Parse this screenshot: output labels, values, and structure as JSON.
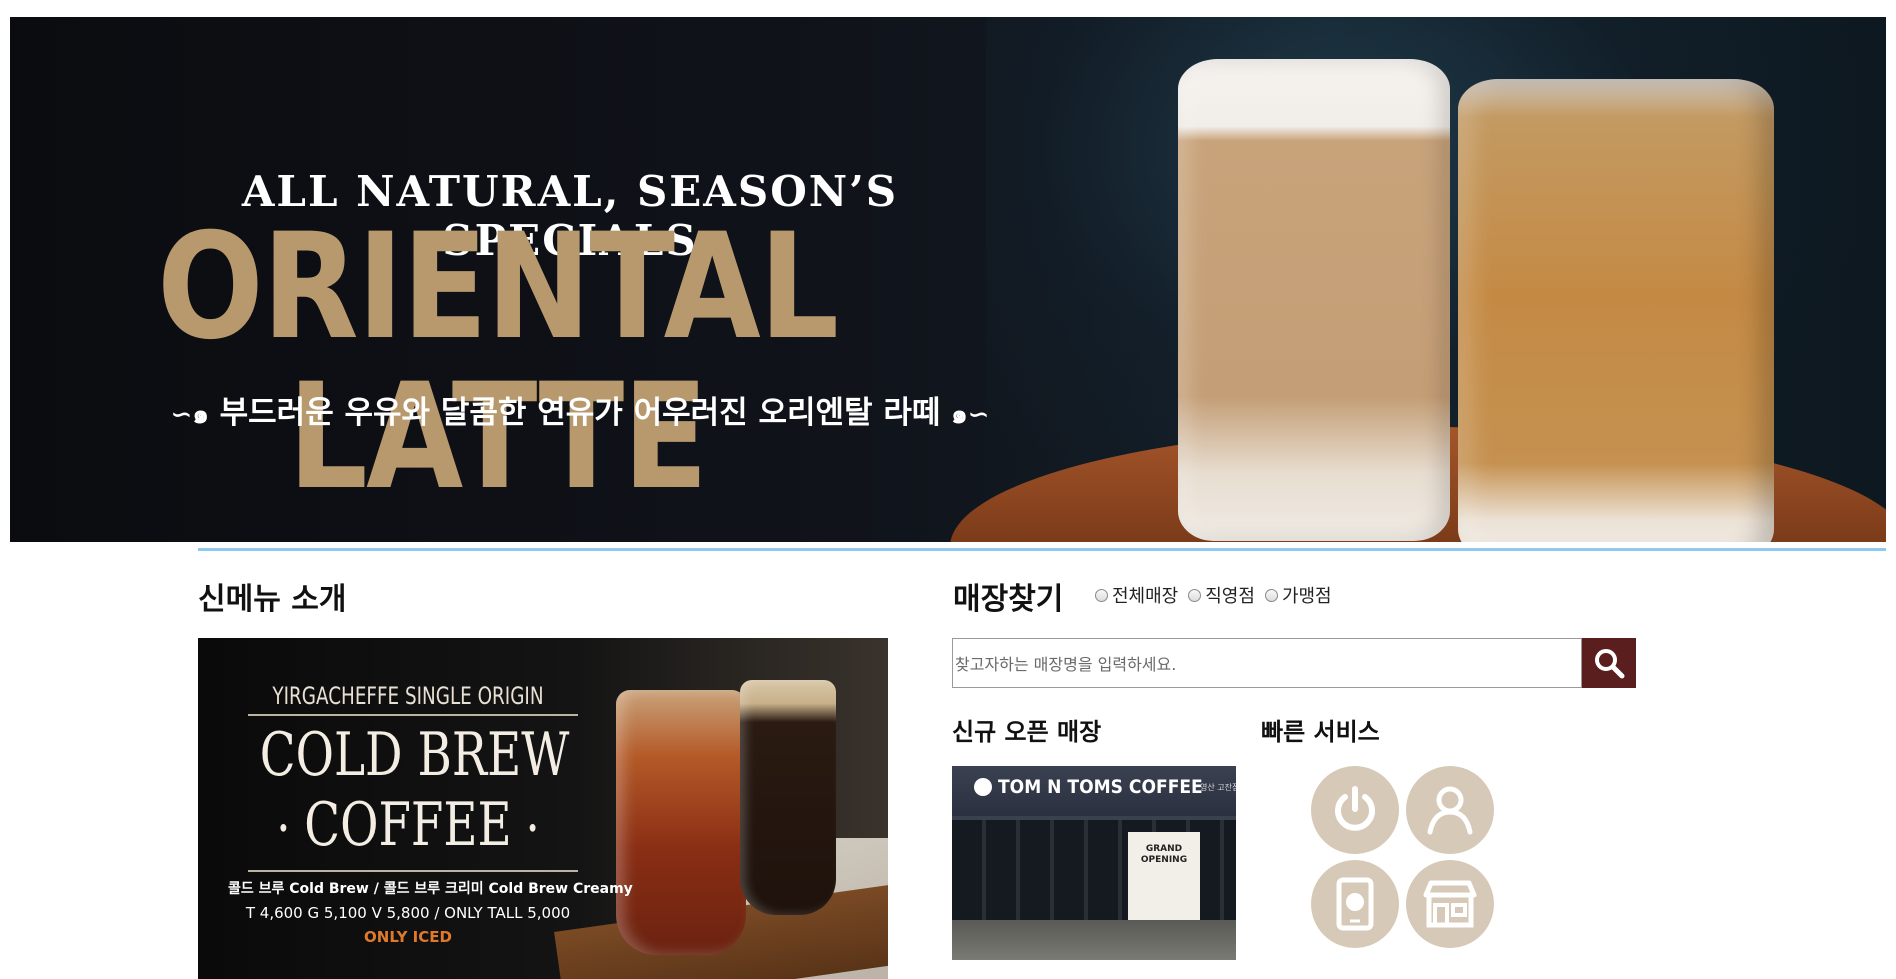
{
  "banner": {
    "subtitle": "ALL NATURAL, SEASON’S SPECIALS",
    "title": "ORIENTAL LATTE",
    "tagline": "부드러운 우유와 달콤한 연유가 어우러진 오리엔탈 라떼",
    "title_color": "#b8996d"
  },
  "new_menu": {
    "heading": "신메뉴 소개",
    "card": {
      "origin": "YIRGACHEFFE SINGLE ORIGIN",
      "line1": "COLD BREW",
      "line2": "COFFEE",
      "names": "콜드 브루  Cold Brew  /  콜드 브루 크리미 Cold Brew Creamy",
      "prices": "T 4,600  G 5,100  V 5,800 / ONLY TALL 5,000",
      "note": "ONLY ICED"
    }
  },
  "store_finder": {
    "heading": "매장찾기",
    "filters": [
      {
        "label": "전체매장",
        "checked": false
      },
      {
        "label": "직영점",
        "checked": false
      },
      {
        "label": "가맹점",
        "checked": false
      }
    ],
    "search": {
      "placeholder": "찾고자하는 매장명을 입력하세요.",
      "value": "",
      "button_icon": "search-icon",
      "button_color": "#5a1e1e"
    }
  },
  "new_store": {
    "heading": "신규 오픈 매장",
    "sign_text": "TOM N TOMS COFFEE",
    "branch_text": "영산 고잔점",
    "poster_text": "GRAND OPENING"
  },
  "quick_service": {
    "heading": "빠른 서비스",
    "icons": [
      "power-icon",
      "user-icon",
      "mobile-globe-icon",
      "store-icon"
    ],
    "icon_bg": "#d7c9b7"
  }
}
